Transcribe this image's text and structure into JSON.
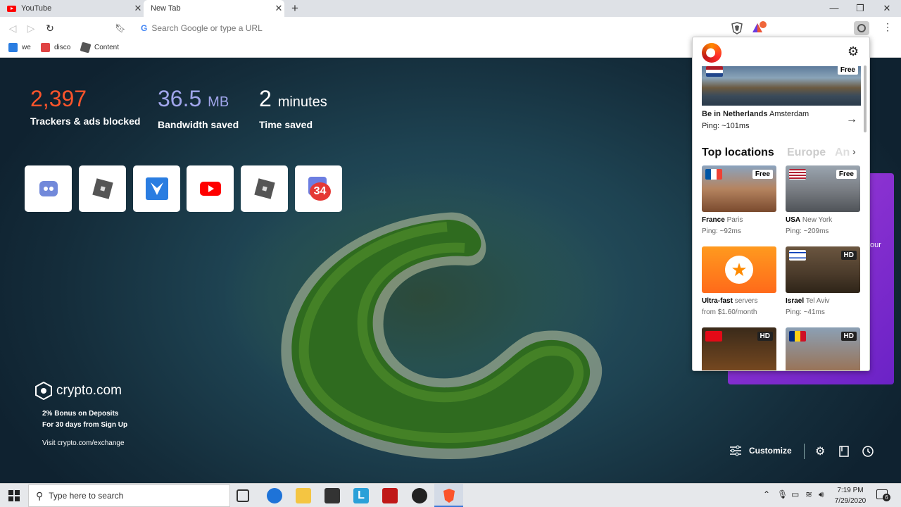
{
  "tabs": [
    {
      "title": "YouTube"
    },
    {
      "title": "New Tab"
    }
  ],
  "omnibox": {
    "placeholder": "Search Google or type a URL"
  },
  "bookmarks": [
    {
      "label": "we"
    },
    {
      "label": "disco"
    },
    {
      "label": "Content"
    }
  ],
  "stats": [
    {
      "value": "2,397",
      "unit": "",
      "label": "Trackers & ads blocked",
      "color": "#fb542b"
    },
    {
      "value": "36.5",
      "unit": "MB",
      "label": "Bandwidth saved",
      "color": "#a0a5eb"
    },
    {
      "value": "2",
      "unit": "minutes",
      "label": "Time saved",
      "color": "#ffffff"
    }
  ],
  "top_sites": [
    "discord-icon",
    "roblox-icon",
    "app-icon",
    "youtube-icon",
    "roblox-icon",
    "calendar-icon"
  ],
  "calendar_badge": "34",
  "crypto": {
    "brand": "crypto.com",
    "line1": "2% Bonus on Deposits",
    "line2": "For 30 days from Sign Up",
    "link": "Visit crypto.com/exchange"
  },
  "customize_label": "Customize",
  "purple_partial": "our",
  "vpn": {
    "featured": {
      "country": "Be in Netherlands",
      "city": "Amsterdam",
      "ping": "Ping: ~101ms",
      "badge": "Free"
    },
    "section_title": "Top locations",
    "section_tabs": [
      "Europe",
      "An"
    ],
    "cards": [
      {
        "country": "France",
        "city": "Paris",
        "ping": "Ping: ~92ms",
        "badge": "Free"
      },
      {
        "country": "USA",
        "city": "New York",
        "ping": "Ping: ~209ms",
        "badge": "Free"
      },
      {
        "country": "Ultra-fast",
        "city": "servers",
        "ping": "from $1.60/month",
        "badge": ""
      },
      {
        "country": "Israel",
        "city": "Tel Aviv",
        "ping": "Ping: ~41ms",
        "badge": "HD"
      },
      {
        "country": "",
        "city": "",
        "ping": "",
        "badge": "HD"
      },
      {
        "country": "",
        "city": "",
        "ping": "",
        "badge": "HD"
      }
    ]
  },
  "taskbar": {
    "search_placeholder": "Type here to search",
    "time": "7:19 PM",
    "date": "7/29/2020",
    "notif_count": "6"
  }
}
